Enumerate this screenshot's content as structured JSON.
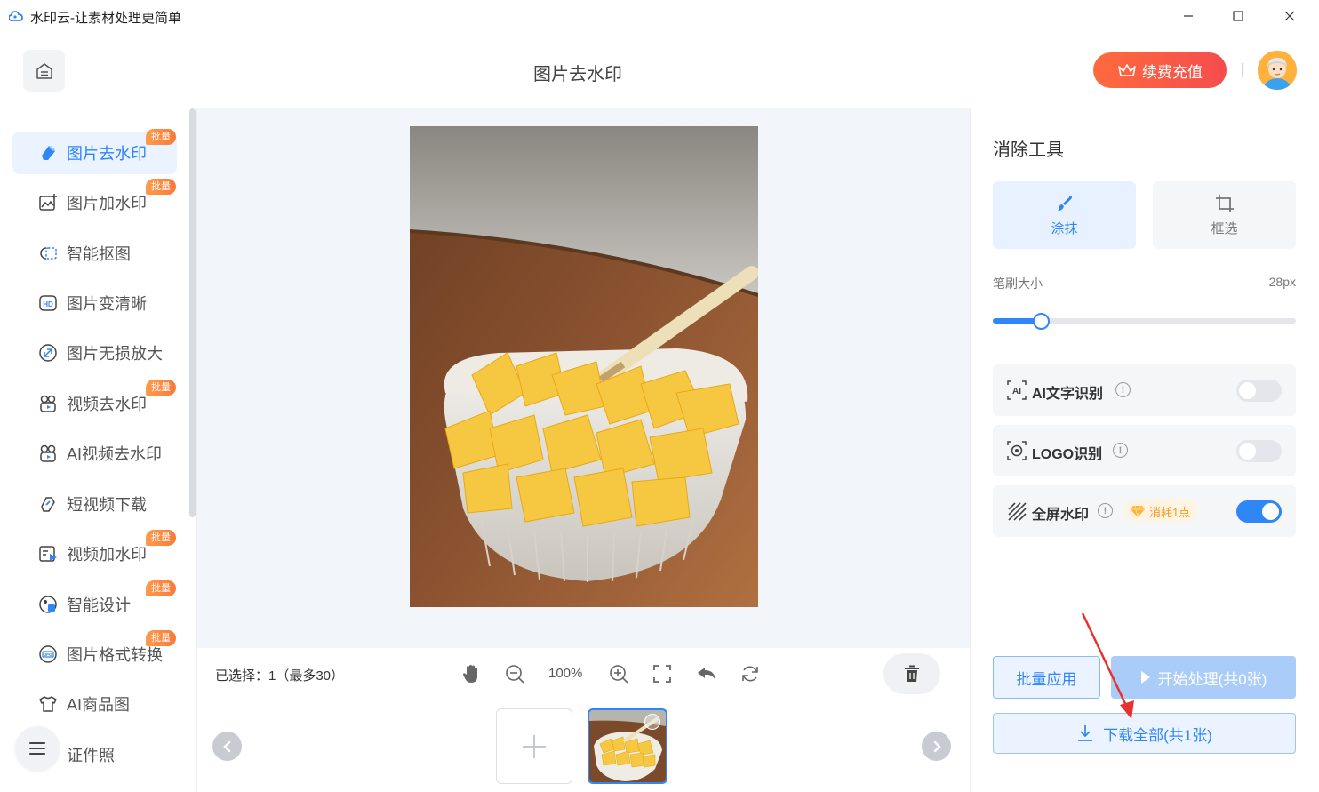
{
  "window": {
    "title": "水印云-让素材处理更简单",
    "controls": [
      "minimize-icon",
      "maximize-icon",
      "close-icon"
    ]
  },
  "header": {
    "home_icon": "home-icon",
    "title": "图片去水印",
    "recharge_label": "续费充值",
    "recharge_icon": "crown-icon"
  },
  "sidebar": {
    "items": [
      {
        "label": "图片去水印",
        "icon": "eraser-icon",
        "badge": "批量",
        "active": true
      },
      {
        "label": "图片加水印",
        "icon": "image-add-icon",
        "badge": "批量"
      },
      {
        "label": "智能抠图",
        "icon": "cutout-icon",
        "badge": ""
      },
      {
        "label": "图片变清晰",
        "icon": "hd-icon",
        "badge": ""
      },
      {
        "label": "图片无损放大",
        "icon": "expand-icon",
        "badge": ""
      },
      {
        "label": "视频去水印",
        "icon": "video-icon",
        "badge": "批量"
      },
      {
        "label": "AI视频去水印",
        "icon": "ai-video-icon",
        "badge": ""
      },
      {
        "label": "短视频下载",
        "icon": "link-icon",
        "badge": ""
      },
      {
        "label": "视频加水印",
        "icon": "video-play-icon",
        "badge": "批量"
      },
      {
        "label": "智能设计",
        "icon": "design-icon",
        "badge": "批量"
      },
      {
        "label": "图片格式转换",
        "icon": "jpg-icon",
        "badge": "批量"
      },
      {
        "label": "AI商品图",
        "icon": "shirt-icon",
        "badge": ""
      },
      {
        "label": "证件照",
        "icon": "id-photo-icon",
        "badge": ""
      }
    ],
    "menu_icon": "menu-icon"
  },
  "toolbar": {
    "selected_text": "已选择：1（最多30）",
    "zoom": "100%",
    "icons": [
      "hand-icon",
      "zoom-out-icon",
      "zoom-in-icon",
      "fullscreen-icon",
      "undo-icon",
      "reset-icon",
      "trash-icon"
    ]
  },
  "thumbs": {
    "add_icon": "plus-icon",
    "count": 1
  },
  "panel": {
    "title": "消除工具",
    "tools": [
      {
        "label": "涂抹",
        "icon": "brush-icon",
        "active": true
      },
      {
        "label": "框选",
        "icon": "crop-icon",
        "active": false
      }
    ],
    "brush_label": "笔刷大小",
    "brush_value": "28px",
    "brush_level": 0.16,
    "options": [
      {
        "label": "AI文字识别",
        "icon": "ai-text-icon",
        "on": false
      },
      {
        "label": "LOGO识别",
        "icon": "logo-detect-icon",
        "on": false
      },
      {
        "label": "全屏水印",
        "icon": "fullscreen-watermark-icon",
        "on": true,
        "cost": "消耗1点"
      }
    ],
    "batch_label": "批量应用",
    "start_label": "开始处理(共0张)",
    "download_label": "下载全部(共1张)"
  },
  "colors": {
    "accent": "#2e86f7",
    "recharge": "#f44d4d",
    "badge": "#f97a3b",
    "annotation": "#e8322e"
  }
}
